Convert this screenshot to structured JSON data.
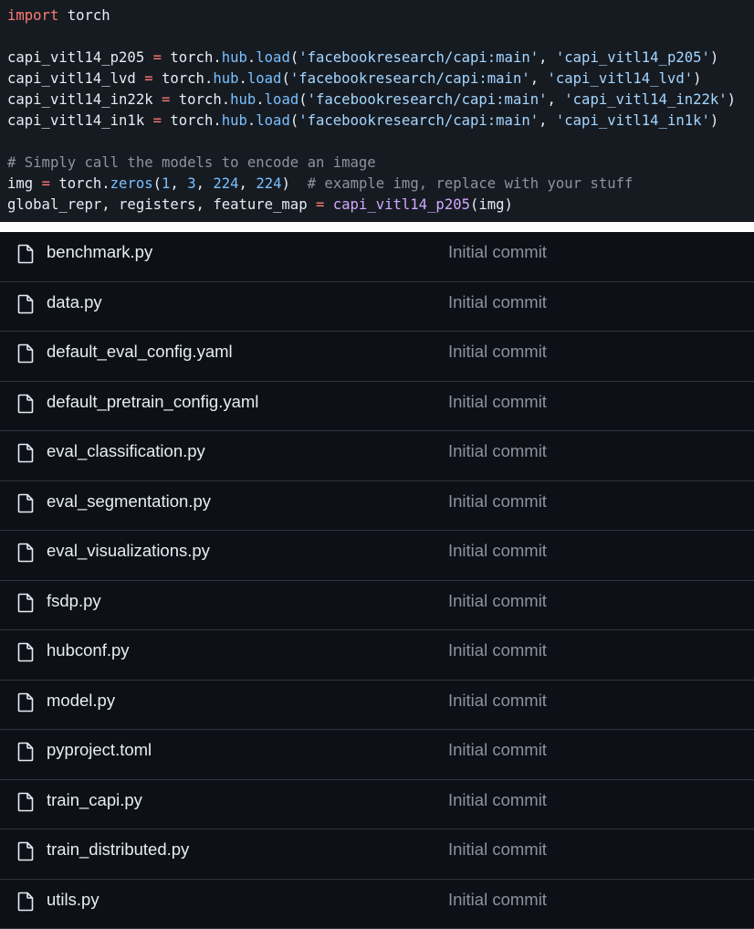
{
  "code": {
    "lines": [
      [
        {
          "t": "import",
          "c": "kw"
        },
        {
          "t": " torch",
          "c": ""
        }
      ],
      [],
      [
        {
          "t": "capi_vitl14_p205 ",
          "c": ""
        },
        {
          "t": "=",
          "c": "op"
        },
        {
          "t": " torch.",
          "c": ""
        },
        {
          "t": "hub",
          "c": "attr"
        },
        {
          "t": ".",
          "c": ""
        },
        {
          "t": "load",
          "c": "attr"
        },
        {
          "t": "(",
          "c": ""
        },
        {
          "t": "'facebookresearch/capi:main'",
          "c": "str"
        },
        {
          "t": ", ",
          "c": ""
        },
        {
          "t": "'capi_vitl14_p205'",
          "c": "str"
        },
        {
          "t": ")",
          "c": ""
        }
      ],
      [
        {
          "t": "capi_vitl14_lvd ",
          "c": ""
        },
        {
          "t": "=",
          "c": "op"
        },
        {
          "t": " torch.",
          "c": ""
        },
        {
          "t": "hub",
          "c": "attr"
        },
        {
          "t": ".",
          "c": ""
        },
        {
          "t": "load",
          "c": "attr"
        },
        {
          "t": "(",
          "c": ""
        },
        {
          "t": "'facebookresearch/capi:main'",
          "c": "str"
        },
        {
          "t": ", ",
          "c": ""
        },
        {
          "t": "'capi_vitl14_lvd'",
          "c": "str"
        },
        {
          "t": ")",
          "c": ""
        }
      ],
      [
        {
          "t": "capi_vitl14_in22k ",
          "c": ""
        },
        {
          "t": "=",
          "c": "op"
        },
        {
          "t": " torch.",
          "c": ""
        },
        {
          "t": "hub",
          "c": "attr"
        },
        {
          "t": ".",
          "c": ""
        },
        {
          "t": "load",
          "c": "attr"
        },
        {
          "t": "(",
          "c": ""
        },
        {
          "t": "'facebookresearch/capi:main'",
          "c": "str"
        },
        {
          "t": ", ",
          "c": ""
        },
        {
          "t": "'capi_vitl14_in22k'",
          "c": "str"
        },
        {
          "t": ")",
          "c": ""
        }
      ],
      [
        {
          "t": "capi_vitl14_in1k ",
          "c": ""
        },
        {
          "t": "=",
          "c": "op"
        },
        {
          "t": " torch.",
          "c": ""
        },
        {
          "t": "hub",
          "c": "attr"
        },
        {
          "t": ".",
          "c": ""
        },
        {
          "t": "load",
          "c": "attr"
        },
        {
          "t": "(",
          "c": ""
        },
        {
          "t": "'facebookresearch/capi:main'",
          "c": "str"
        },
        {
          "t": ", ",
          "c": ""
        },
        {
          "t": "'capi_vitl14_in1k'",
          "c": "str"
        },
        {
          "t": ")",
          "c": ""
        }
      ],
      [],
      [
        {
          "t": "# Simply call the models to encode an image",
          "c": "cmt"
        }
      ],
      [
        {
          "t": "img ",
          "c": ""
        },
        {
          "t": "=",
          "c": "op"
        },
        {
          "t": " torch.",
          "c": ""
        },
        {
          "t": "zeros",
          "c": "attr"
        },
        {
          "t": "(",
          "c": ""
        },
        {
          "t": "1",
          "c": "num"
        },
        {
          "t": ", ",
          "c": ""
        },
        {
          "t": "3",
          "c": "num"
        },
        {
          "t": ", ",
          "c": ""
        },
        {
          "t": "224",
          "c": "num"
        },
        {
          "t": ", ",
          "c": ""
        },
        {
          "t": "224",
          "c": "num"
        },
        {
          "t": ")  ",
          "c": ""
        },
        {
          "t": "# example img, replace with your stuff",
          "c": "cmt"
        }
      ],
      [
        {
          "t": "global_repr, registers, feature_map ",
          "c": ""
        },
        {
          "t": "=",
          "c": "op"
        },
        {
          "t": " ",
          "c": ""
        },
        {
          "t": "capi_vitl14_p205",
          "c": "fn"
        },
        {
          "t": "(img)",
          "c": ""
        }
      ]
    ]
  },
  "files": [
    {
      "name": "benchmark.py",
      "commit": "Initial commit",
      "icon": "file-icon"
    },
    {
      "name": "data.py",
      "commit": "Initial commit",
      "icon": "file-icon"
    },
    {
      "name": "default_eval_config.yaml",
      "commit": "Initial commit",
      "icon": "file-icon"
    },
    {
      "name": "default_pretrain_config.yaml",
      "commit": "Initial commit",
      "icon": "file-icon"
    },
    {
      "name": "eval_classification.py",
      "commit": "Initial commit",
      "icon": "file-icon"
    },
    {
      "name": "eval_segmentation.py",
      "commit": "Initial commit",
      "icon": "file-icon"
    },
    {
      "name": "eval_visualizations.py",
      "commit": "Initial commit",
      "icon": "file-icon"
    },
    {
      "name": "fsdp.py",
      "commit": "Initial commit",
      "icon": "file-icon"
    },
    {
      "name": "hubconf.py",
      "commit": "Initial commit",
      "icon": "file-icon"
    },
    {
      "name": "model.py",
      "commit": "Initial commit",
      "icon": "file-icon"
    },
    {
      "name": "pyproject.toml",
      "commit": "Initial commit",
      "icon": "file-icon"
    },
    {
      "name": "train_capi.py",
      "commit": "Initial commit",
      "icon": "file-icon"
    },
    {
      "name": "train_distributed.py",
      "commit": "Initial commit",
      "icon": "file-icon"
    },
    {
      "name": "utils.py",
      "commit": "Initial commit",
      "icon": "file-icon"
    }
  ],
  "colors": {
    "background": "#0d1117",
    "code_background": "#161b22",
    "text": "#e6edf3",
    "muted": "#8b949e",
    "keyword": "#ff7b72",
    "attribute": "#79c0ff",
    "string": "#a5d6ff",
    "function": "#d2a8ff",
    "border": "#30363d"
  }
}
